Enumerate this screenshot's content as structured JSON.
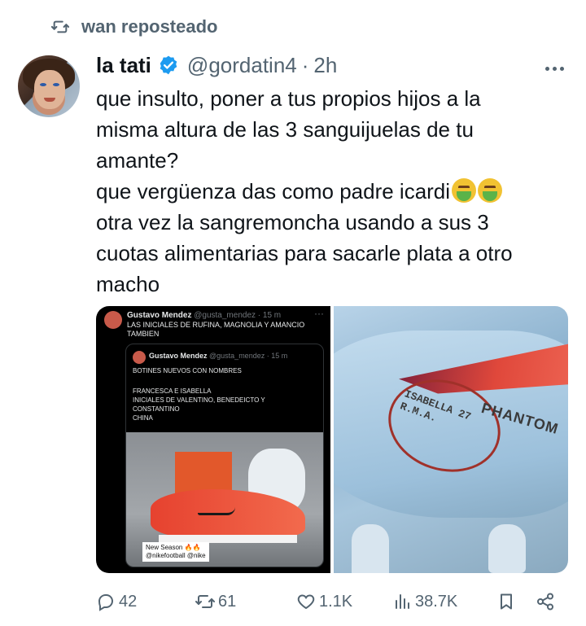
{
  "repost": {
    "icon": "repost-icon",
    "text": "wan reposteado"
  },
  "author": {
    "name": "la tati",
    "verified": true,
    "handle": "@gordatin4",
    "separator": "·",
    "time": "2h",
    "avatar": "avatar-photo"
  },
  "tweet_lines": [
    "que insulto, poner a tus propios hijos a la",
    "misma altura de las 3 sanguijuelas de tu",
    "amante?",
    "que vergüenza das como padre icardi",
    "otra vez la sangremoncha usando a sus 3",
    "cuotas alimentarias para sacarle plata a otro",
    "macho"
  ],
  "media": {
    "screenshot": {
      "name": "Gustavo Mendez",
      "handle_time": "@gusta_mendez · 15 m",
      "dots": "···",
      "text": "LAS INICIALES DE RUFINA, MAGNOLIA Y AMANCIO TAMBIEN",
      "quoted": {
        "name": "Gustavo Mendez",
        "handle_time": "@gusta_mendez · 15 m",
        "line1": "BOTINES NUEVOS CON NOMBRES",
        "line2": "FRANCESCA E ISABELLA",
        "line3": "INICIALES DE VALENTINO, BENEDEICTO Y",
        "line4": "CONSTANTINO",
        "line5": "CHINA",
        "ig_line1": "New Season 🔥🔥",
        "ig_line2": "@nikefootball @nike"
      }
    },
    "closeup": {
      "line1": "ISABELLA 27",
      "line2": "R.M.A.",
      "brand": "PHANTOM"
    }
  },
  "actions": {
    "reply": {
      "icon": "reply-icon",
      "count": "42"
    },
    "repost": {
      "icon": "repost-icon",
      "count": "61"
    },
    "like": {
      "icon": "heart-icon",
      "count": "1.1K"
    },
    "views": {
      "icon": "views-icon",
      "count": "38.7K"
    },
    "bookmark": {
      "icon": "bookmark-icon"
    },
    "share": {
      "icon": "share-icon"
    }
  },
  "colors": {
    "text": "#0f1419",
    "secondary": "#536471",
    "verified": "#1d9bf0"
  }
}
